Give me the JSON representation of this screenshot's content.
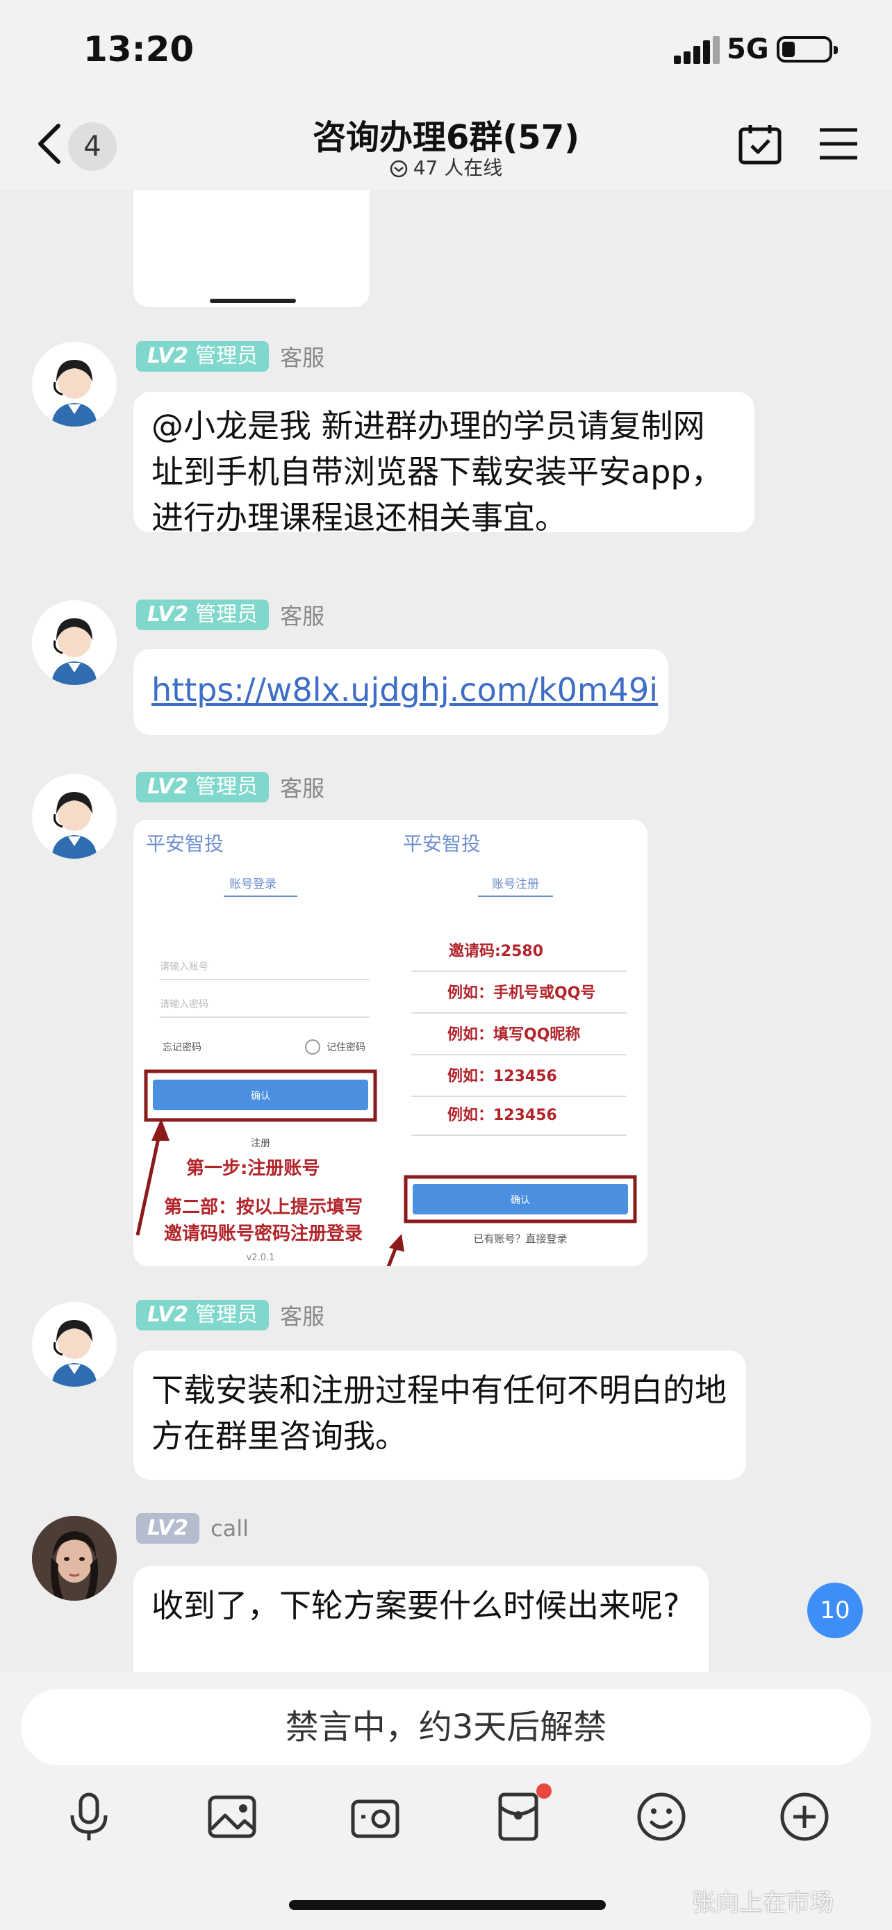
{
  "status_bar": {
    "time": "13:20",
    "network": "5G",
    "battery_level": 0.2
  },
  "nav": {
    "back_count": "4",
    "title": "咨询办理6群(57)",
    "online": "47 人在线",
    "icons": [
      "back-arrow-icon",
      "calendar-check-icon",
      "menu-icon"
    ]
  },
  "messages": [
    {
      "level": "LV2",
      "role": "管理员",
      "sender": "客服",
      "text": "@小龙是我 新进群办理的学员请复制网址到手机自带浏览器下载安装平安app，进行办理课程退还相关事宜。"
    },
    {
      "level": "LV2",
      "role": "管理员",
      "sender": "客服",
      "link": "https://w8lx.ujdghj.com/k0m49i"
    },
    {
      "level": "LV2",
      "role": "管理员",
      "sender": "客服",
      "image": {
        "left": {
          "app_title": "平安智投",
          "tab": "账号登录",
          "field1": "请输入账号",
          "field2": "请输入密码",
          "forgot": "忘记密码",
          "remember": "记住密码",
          "confirm": "确认",
          "register": "注册",
          "step1": "第一步:注册账号",
          "step2_line1": "第二部：按以上提示填写",
          "step2_line2": "邀请码账号密码注册登录",
          "version": "v2.0.1"
        },
        "right": {
          "app_title": "平安智投",
          "tab": "账号注册",
          "invite": "邀请码:2580",
          "ex1": "例如：手机号或QQ号",
          "ex2": "例如：填写QQ昵称",
          "ex3": "例如：123456",
          "ex4": "例如：123456",
          "confirm": "确认",
          "login_link": "已有账号？直接登录"
        }
      }
    },
    {
      "level": "LV2",
      "role": "管理员",
      "sender": "客服",
      "text": "下载安装和注册过程中有任何不明白的地方在群里咨询我。"
    },
    {
      "level": "LV2",
      "sender": "call",
      "text": "收到了，下轮方案要什么时候出来呢?"
    }
  ],
  "unread_count": "10",
  "input": {
    "muted_text": "禁言中，约3天后解禁"
  },
  "toolbar": [
    "microphone-icon",
    "image-icon",
    "camera-icon",
    "red-packet-icon",
    "emoji-icon",
    "plus-icon"
  ],
  "watermark": "张向上在市场"
}
